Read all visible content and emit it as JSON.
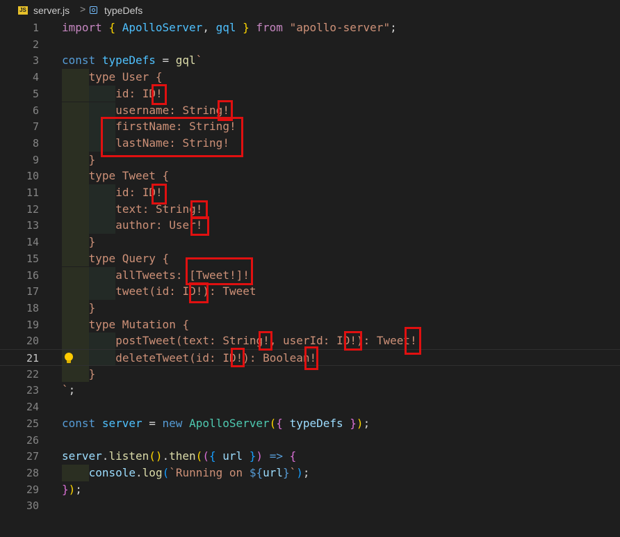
{
  "breadcrumb": {
    "file_badge": "JS",
    "file_name": "server.js",
    "separator": ">",
    "symbol_icon": "symbol-variable-icon",
    "symbol_name": "typeDefs"
  },
  "editor": {
    "current_line": 21,
    "lightbulb_line": 21,
    "lines": [
      {
        "n": 1,
        "indent": 0,
        "tokens": [
          [
            "kw2",
            "import"
          ],
          [
            "plain",
            " "
          ],
          [
            "p1",
            "{"
          ],
          [
            "plain",
            " "
          ],
          [
            "var",
            "ApolloServer"
          ],
          [
            "plain",
            ", "
          ],
          [
            "var",
            "gql"
          ],
          [
            "plain",
            " "
          ],
          [
            "p1",
            "}"
          ],
          [
            "plain",
            " "
          ],
          [
            "kw2",
            "from"
          ],
          [
            "plain",
            " "
          ],
          [
            "str",
            "\"apollo-server\""
          ],
          [
            "plain",
            ";"
          ]
        ]
      },
      {
        "n": 2,
        "indent": 0,
        "tokens": []
      },
      {
        "n": 3,
        "indent": 0,
        "tokens": [
          [
            "kw",
            "const"
          ],
          [
            "plain",
            " "
          ],
          [
            "var",
            "typeDefs"
          ],
          [
            "plain",
            " = "
          ],
          [
            "fn",
            "gql"
          ],
          [
            "gql",
            "`"
          ]
        ]
      },
      {
        "n": 4,
        "indent": 1,
        "tokens": [
          [
            "gql",
            "type User {"
          ]
        ]
      },
      {
        "n": 5,
        "indent": 2,
        "tokens": [
          [
            "gql",
            "id: ID!"
          ]
        ]
      },
      {
        "n": 6,
        "indent": 2,
        "tokens": [
          [
            "gql",
            "username: String!"
          ]
        ]
      },
      {
        "n": 7,
        "indent": 2,
        "tokens": [
          [
            "gql",
            "firstName: String!"
          ]
        ]
      },
      {
        "n": 8,
        "indent": 2,
        "tokens": [
          [
            "gql",
            "lastName: String!"
          ]
        ]
      },
      {
        "n": 9,
        "indent": 1,
        "tokens": [
          [
            "gql",
            "}"
          ]
        ]
      },
      {
        "n": 10,
        "indent": 1,
        "tokens": [
          [
            "gql",
            "type Tweet {"
          ]
        ]
      },
      {
        "n": 11,
        "indent": 2,
        "tokens": [
          [
            "gql",
            "id: ID!"
          ]
        ]
      },
      {
        "n": 12,
        "indent": 2,
        "tokens": [
          [
            "gql",
            "text: String!"
          ]
        ]
      },
      {
        "n": 13,
        "indent": 2,
        "tokens": [
          [
            "gql",
            "author: User!"
          ]
        ]
      },
      {
        "n": 14,
        "indent": 1,
        "tokens": [
          [
            "gql",
            "}"
          ]
        ]
      },
      {
        "n": 15,
        "indent": 1,
        "tokens": [
          [
            "gql",
            "type Query {"
          ]
        ]
      },
      {
        "n": 16,
        "indent": 2,
        "tokens": [
          [
            "gql",
            "allTweets: [Tweet!]!"
          ]
        ]
      },
      {
        "n": 17,
        "indent": 2,
        "tokens": [
          [
            "gql",
            "tweet(id: ID!): Tweet"
          ]
        ]
      },
      {
        "n": 18,
        "indent": 1,
        "tokens": [
          [
            "gql",
            "}"
          ]
        ]
      },
      {
        "n": 19,
        "indent": 1,
        "tokens": [
          [
            "gql",
            "type Mutation {"
          ]
        ]
      },
      {
        "n": 20,
        "indent": 2,
        "tokens": [
          [
            "gql",
            "postTweet(text: String!, userId: ID!): Tweet!"
          ]
        ]
      },
      {
        "n": 21,
        "indent": 2,
        "tokens": [
          [
            "gql",
            "deleteTweet(id: ID!): Boolean!"
          ]
        ]
      },
      {
        "n": 22,
        "indent": 1,
        "tokens": [
          [
            "gql",
            "}"
          ]
        ]
      },
      {
        "n": 23,
        "indent": 0,
        "tokens": [
          [
            "gql",
            "`"
          ],
          [
            "plain",
            ";"
          ]
        ]
      },
      {
        "n": 24,
        "indent": 0,
        "tokens": []
      },
      {
        "n": 25,
        "indent": 0,
        "tokens": [
          [
            "kw",
            "const"
          ],
          [
            "plain",
            " "
          ],
          [
            "var",
            "server"
          ],
          [
            "plain",
            " = "
          ],
          [
            "kw",
            "new"
          ],
          [
            "plain",
            " "
          ],
          [
            "cls",
            "ApolloServer"
          ],
          [
            "p1",
            "("
          ],
          [
            "p2",
            "{"
          ],
          [
            "plain",
            " "
          ],
          [
            "id",
            "typeDefs"
          ],
          [
            "plain",
            " "
          ],
          [
            "p2",
            "}"
          ],
          [
            "p1",
            ")"
          ],
          [
            "plain",
            ";"
          ]
        ]
      },
      {
        "n": 26,
        "indent": 0,
        "tokens": []
      },
      {
        "n": 27,
        "indent": 0,
        "tokens": [
          [
            "id",
            "server"
          ],
          [
            "plain",
            "."
          ],
          [
            "fn",
            "listen"
          ],
          [
            "p1",
            "()"
          ],
          [
            "plain",
            "."
          ],
          [
            "fn",
            "then"
          ],
          [
            "p1",
            "("
          ],
          [
            "p2",
            "("
          ],
          [
            "p3",
            "{"
          ],
          [
            "plain",
            " "
          ],
          [
            "id",
            "url"
          ],
          [
            "plain",
            " "
          ],
          [
            "p3",
            "}"
          ],
          [
            "p2",
            ")"
          ],
          [
            "plain",
            " "
          ],
          [
            "kw",
            "=>"
          ],
          [
            "plain",
            " "
          ],
          [
            "p2",
            "{"
          ]
        ]
      },
      {
        "n": 28,
        "indent": 1,
        "tokens": [
          [
            "id",
            "console"
          ],
          [
            "plain",
            "."
          ],
          [
            "fn",
            "log"
          ],
          [
            "p3",
            "("
          ],
          [
            "str",
            "`Running on "
          ],
          [
            "kw",
            "${"
          ],
          [
            "id",
            "url"
          ],
          [
            "kw",
            "}"
          ],
          [
            "str",
            "`"
          ],
          [
            "p3",
            ")"
          ],
          [
            "plain",
            ";"
          ]
        ]
      },
      {
        "n": 29,
        "indent": 0,
        "tokens": [
          [
            "p2",
            "}"
          ],
          [
            "p1",
            ")"
          ],
          [
            "plain",
            ";"
          ]
        ]
      },
      {
        "n": 30,
        "indent": 0,
        "tokens": []
      }
    ]
  },
  "annotation_color": "#e01010"
}
